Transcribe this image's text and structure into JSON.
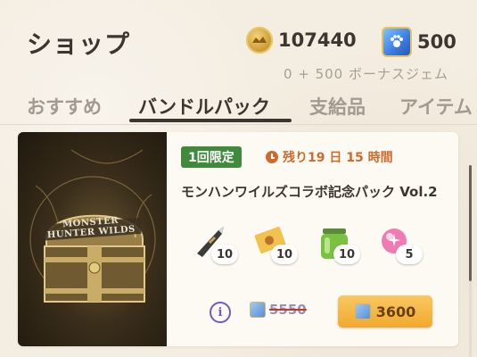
{
  "header": {
    "title": "ショップ"
  },
  "currency": {
    "coins": "107440",
    "gems": "500",
    "bonus_text": "0 + 500 ボーナスジェム",
    "coin_icon": "coin-icon",
    "gem_icon": "gem-icon"
  },
  "tabs": [
    {
      "label": "おすすめ",
      "active": false
    },
    {
      "label": "バンドルパック",
      "active": true
    },
    {
      "label": "支給品",
      "active": false
    },
    {
      "label": "アイテム",
      "active": false
    }
  ],
  "bundle": {
    "limited_label": "1回限定",
    "timer_text": "残り19 日 15 時間",
    "name": "モンハンワイルズコラボ記念パック Vol.2",
    "image_text": "MONSTER HUNTER WILDS",
    "items": [
      {
        "icon": "knife-icon",
        "qty": "10"
      },
      {
        "icon": "ticket-icon",
        "qty": "10"
      },
      {
        "icon": "potion-jar-icon",
        "qty": "10"
      },
      {
        "icon": "pink-orb-icon",
        "qty": "5"
      }
    ],
    "old_price": "5550",
    "price": "3600"
  },
  "colors": {
    "background": "#f4ede1",
    "limited_badge": "#3f8a3c",
    "timer": "#d06a2c",
    "buy_button": "#f1a92d",
    "info": "#6b5cc2"
  }
}
